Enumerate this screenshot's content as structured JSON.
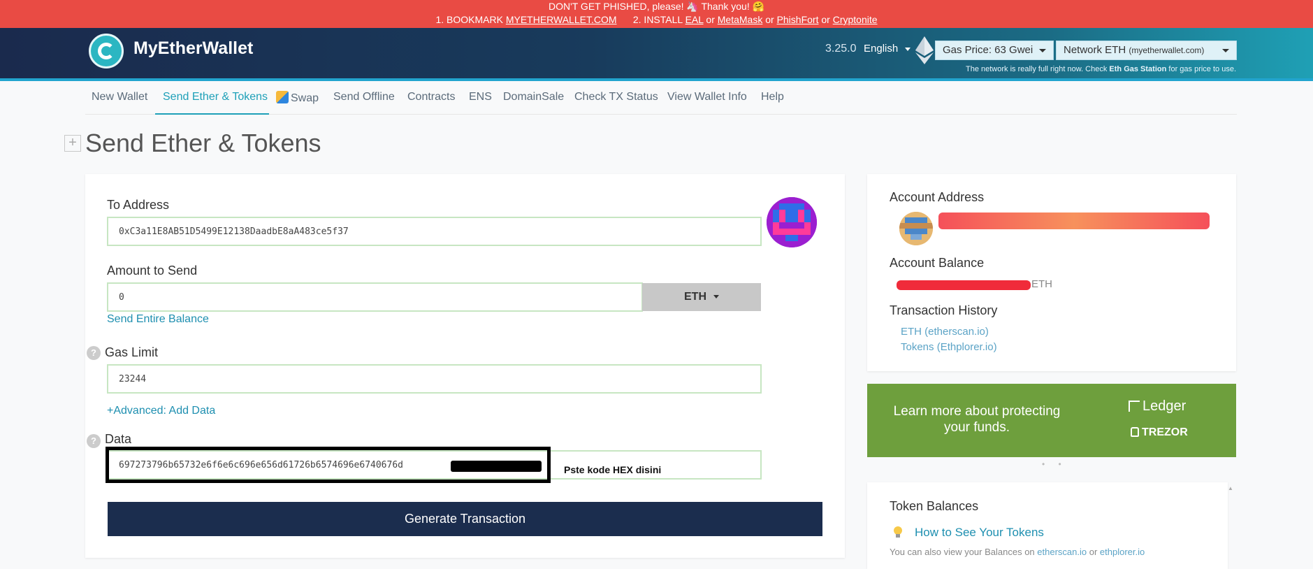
{
  "banner": {
    "line1_prefix": "DON'T GET PHISHED, please! 🦄 Thank you! 🤗",
    "step1": "1. BOOKMARK",
    "bookmark_link": "MYETHERWALLET.COM",
    "step2": "2. INSTALL",
    "ext1": "EAL",
    "or1": "or",
    "ext2": "MetaMask",
    "or2": "or",
    "ext3": "PhishFort",
    "or3": "or",
    "ext4": "Cryptonite"
  },
  "header": {
    "brand": "MyEtherWallet",
    "version": "3.25.0",
    "language": "English",
    "gas_price": "Gas Price: 63 Gwei",
    "network_main": "Network ETH",
    "network_sub": "(myetherwallet.com)",
    "note_prefix": "The network is really full right now. Check",
    "note_link": "Eth Gas Station",
    "note_suffix": "for gas price to use."
  },
  "nav": [
    {
      "label": "New Wallet"
    },
    {
      "label": "Send Ether & Tokens"
    },
    {
      "label": "Swap"
    },
    {
      "label": "Send Offline"
    },
    {
      "label": "Contracts"
    },
    {
      "label": "ENS"
    },
    {
      "label": "DomainSale"
    },
    {
      "label": "Check TX Status"
    },
    {
      "label": "View Wallet Info"
    },
    {
      "label": "Help"
    }
  ],
  "page": {
    "expand_symbol": "+",
    "title": "Send Ether & Tokens"
  },
  "form": {
    "to_label": "To Address",
    "to_value": "0xC3a11E8AB51D5499E12138DaadbE8aA483ce5f37",
    "amount_label": "Amount to Send",
    "amount_value": "0",
    "currency": "ETH",
    "send_entire": "Send Entire Balance",
    "gas_label": "Gas Limit",
    "gas_value": "23244",
    "advanced": "+Advanced: Add Data",
    "data_label": "Data",
    "data_value": "697273796b65732e6f6e6c696e656d61726b6574696e6740676d",
    "data_hint": "Pste kode HEX disini",
    "help_symbol": "?",
    "generate": "Generate Transaction"
  },
  "account": {
    "address_label": "Account Address",
    "balance_label": "Account Balance",
    "balance_unit": "ETH",
    "history_label": "Transaction History",
    "history_links": [
      "ETH (etherscan.io)",
      "Tokens (Ethplorer.io)"
    ]
  },
  "promo": {
    "text": "Learn more about protecting your funds.",
    "brand1": "Ledger",
    "brand2": "TREZOR",
    "dots": "• •"
  },
  "tokens": {
    "title": "Token Balances",
    "how_to": "How to See Your Tokens",
    "note_prefix": "You can also view your Balances on",
    "link1": "etherscan.io",
    "or": "or",
    "link2": "ethplorer.io"
  },
  "colors": {
    "banner": "#e94b44",
    "accent": "#1ea0b8",
    "primary_button": "#1b2d4e",
    "input_border": "#c7e6c2",
    "promo_bg": "#6e9f3d",
    "redaction": "#f02b3a"
  }
}
